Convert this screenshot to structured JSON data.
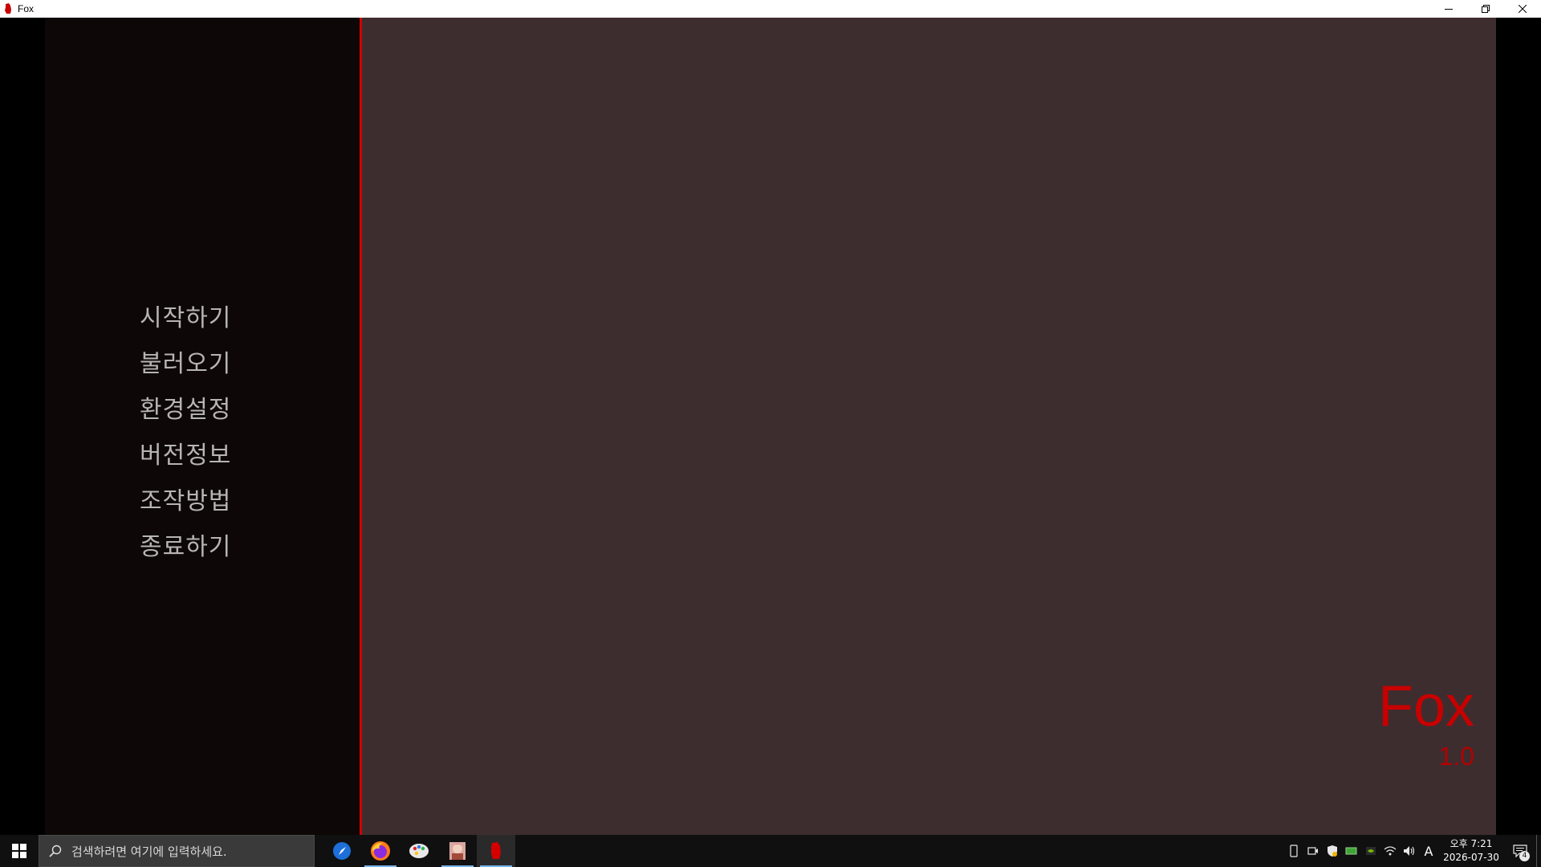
{
  "window": {
    "title": "Fox",
    "controls": [
      "minimize",
      "restore",
      "close"
    ]
  },
  "menu": {
    "items": [
      {
        "label": "시작하기"
      },
      {
        "label": "불러오기"
      },
      {
        "label": "환경설정"
      },
      {
        "label": "버전정보"
      },
      {
        "label": "조작방법"
      },
      {
        "label": "종료하기"
      }
    ]
  },
  "brand": {
    "name": "Fox",
    "version": "1.0"
  },
  "taskbar": {
    "search_placeholder": "검색하려면 여기에 입력하세요.",
    "apps": [
      {
        "icon": "app-blue-compass-icon",
        "active": false
      },
      {
        "icon": "firefox-icon",
        "active": false,
        "underline": true
      },
      {
        "icon": "paint-app-icon",
        "active": false
      },
      {
        "icon": "character-app-icon",
        "active": false,
        "underline": true
      },
      {
        "icon": "fox-app-icon",
        "active": true,
        "underline": true
      }
    ],
    "tray": {
      "ime": "A",
      "time": "오후 7:21",
      "date": "2026-07-30",
      "notification_count": "4"
    }
  },
  "colors": {
    "accent": "#d40000",
    "sidebar_bg": "#0d0707",
    "stage_bg": "#3d2d2f",
    "menu_text": "#b8b4b4"
  }
}
